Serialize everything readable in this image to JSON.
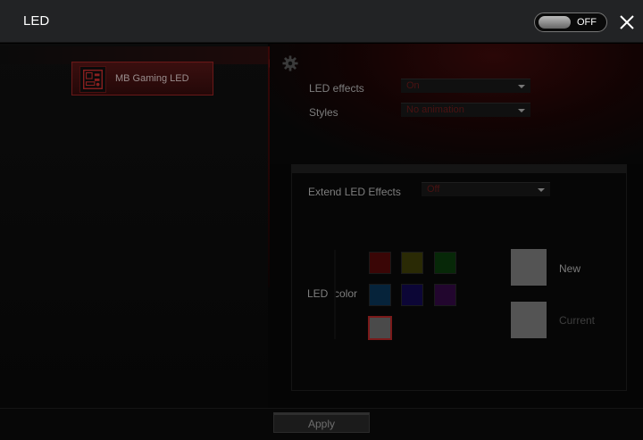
{
  "window": {
    "title": "LED"
  },
  "power_toggle": {
    "label": "OFF",
    "state": "off"
  },
  "devices": [
    {
      "label": "MB Gaming LED",
      "icon": "motherboard-icon",
      "selected": true
    }
  ],
  "settings": {
    "led_effects": {
      "label": "LED effects",
      "value": "On"
    },
    "styles": {
      "label": "Styles",
      "value": "No animation"
    }
  },
  "extend": {
    "label": "Extend LED Effects",
    "value": "Off"
  },
  "led_color": {
    "label_a": "LED",
    "label_b": "color",
    "swatches": [
      {
        "name": "red",
        "color": "#3a0606"
      },
      {
        "name": "yellow",
        "color": "#2a2a05"
      },
      {
        "name": "green",
        "color": "#072808"
      },
      {
        "name": "blue",
        "color": "#06233a"
      },
      {
        "name": "indigo",
        "color": "#0c0636"
      },
      {
        "name": "purple",
        "color": "#22062e"
      },
      {
        "name": "white",
        "color": "#4a4a4a",
        "selected": true
      }
    ],
    "new_label": "New",
    "current_label": "Current"
  },
  "footer": {
    "apply_label": "Apply"
  },
  "colors": {
    "accent": "#6a1818",
    "titlebar": "#222325"
  }
}
